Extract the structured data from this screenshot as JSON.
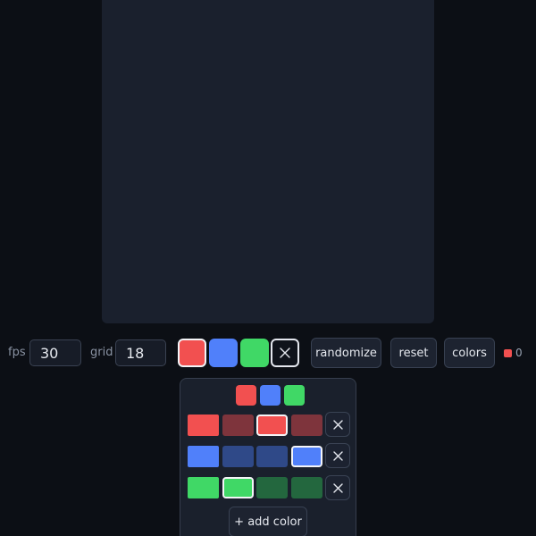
{
  "toolbar": {
    "fps_label": "fps",
    "fps_value": "30",
    "grid_label": "grid",
    "grid_value": "18",
    "swatches": [
      {
        "color": "#f25050",
        "selected": true
      },
      {
        "color": "#5080fa"
      },
      {
        "color": "#40d866"
      }
    ],
    "clear_icon": "close-icon",
    "randomize_label": "randomize",
    "reset_label": "reset",
    "colors_label": "colors",
    "count_color": "#f25050",
    "count_value": "0"
  },
  "palette": {
    "colors": [
      "#f25050",
      "#5080fa",
      "#40d866"
    ],
    "rows": [
      {
        "base": "#f25050",
        "shades": [
          "#7e343c",
          "#f25050",
          "#7e343c"
        ],
        "selected_index": 1
      },
      {
        "base": "#5080fa",
        "shades": [
          "#2f4988",
          "#2f4988",
          "#5080fa"
        ],
        "selected_index": 2
      },
      {
        "base": "#40d866",
        "shades": [
          "#40d866",
          "#23673e",
          "#23673e"
        ],
        "selected_index": 0
      }
    ],
    "remove_icon": "close-icon",
    "add_color_label": "+ add color"
  },
  "colors": {
    "background": "#0c0f15",
    "canvas": "#1a202d",
    "panel": "#1a202c",
    "border": "#384152",
    "text": "#e6e9ef"
  }
}
